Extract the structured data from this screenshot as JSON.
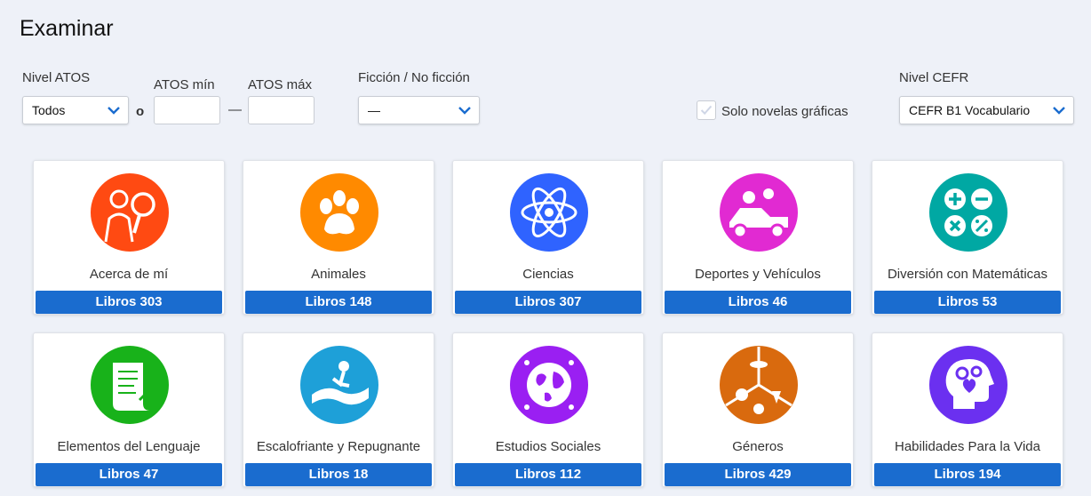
{
  "page": {
    "title": "Examinar"
  },
  "filters": {
    "atos_level": {
      "label": "Nivel ATOS",
      "value": "Todos"
    },
    "or_text": "o",
    "atos_min": {
      "label": "ATOS mín",
      "value": ""
    },
    "dash": "—",
    "atos_max": {
      "label": "ATOS máx",
      "value": ""
    },
    "fiction": {
      "label": "Ficción / No ficción",
      "value": "—"
    },
    "graphic_only": {
      "label": "Solo novelas gráficas",
      "checked": false
    },
    "cefr": {
      "label": "Nivel CEFR",
      "value": "CEFR B1 Vocabulario"
    }
  },
  "categories": [
    {
      "name": "Acerca de mí",
      "count": "Libros 303",
      "icon": "person-magnifier-icon",
      "color": "#ff4a12"
    },
    {
      "name": "Animales",
      "count": "Libros 148",
      "icon": "paw-icon",
      "color": "#ff8a00"
    },
    {
      "name": "Ciencias",
      "count": "Libros 307",
      "icon": "atom-icon",
      "color": "#2f63ff"
    },
    {
      "name": "Deportes y Vehículos",
      "count": "Libros 46",
      "icon": "vehicle-icon",
      "color": "#e12ad2"
    },
    {
      "name": "Diversión con Matemáticas",
      "count": "Libros 53",
      "icon": "math-operators-icon",
      "color": "#00a8a3"
    },
    {
      "name": "Elementos del Lenguaje",
      "count": "Libros 47",
      "icon": "scroll-icon",
      "color": "#18b21a"
    },
    {
      "name": "Escalofriante y Repugnante",
      "count": "Libros 18",
      "icon": "slide-figure-icon",
      "color": "#1ea0d8"
    },
    {
      "name": "Estudios Sociales",
      "count": "Libros 112",
      "icon": "globe-icon",
      "color": "#9a1ff2"
    },
    {
      "name": "Géneros",
      "count": "Libros 429",
      "icon": "genres-wheel-icon",
      "color": "#d96a0e"
    },
    {
      "name": "Habilidades Para la Vida",
      "count": "Libros 194",
      "icon": "head-gears-icon",
      "color": "#6b30f0"
    }
  ]
}
